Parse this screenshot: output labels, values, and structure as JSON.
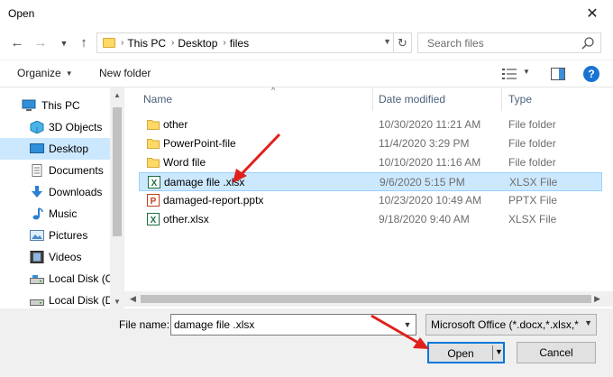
{
  "window": {
    "title": "Open"
  },
  "address": {
    "segments": [
      "This PC",
      "Desktop",
      "files"
    ]
  },
  "search": {
    "placeholder": "Search files"
  },
  "toolbar": {
    "organize": "Organize",
    "new_folder": "New folder"
  },
  "sidebar": {
    "items": [
      {
        "label": "This PC",
        "icon": "computer-icon"
      },
      {
        "label": "3D Objects",
        "icon": "cube-icon"
      },
      {
        "label": "Desktop",
        "icon": "desktop-icon",
        "selected": true
      },
      {
        "label": "Documents",
        "icon": "document-icon"
      },
      {
        "label": "Downloads",
        "icon": "download-icon"
      },
      {
        "label": "Music",
        "icon": "music-icon"
      },
      {
        "label": "Pictures",
        "icon": "pictures-icon"
      },
      {
        "label": "Videos",
        "icon": "video-icon"
      },
      {
        "label": "Local Disk (C",
        "icon": "disk-icon"
      },
      {
        "label": "Local Disk (D",
        "icon": "disk-icon"
      }
    ]
  },
  "columns": {
    "name": "Name",
    "date": "Date modified",
    "type": "Type"
  },
  "files": [
    {
      "name": "other",
      "date": "10/30/2020 11:21 AM",
      "type": "File folder",
      "icon": "folder-icon"
    },
    {
      "name": "PowerPoint-file",
      "date": "11/4/2020 3:29 PM",
      "type": "File folder",
      "icon": "folder-icon"
    },
    {
      "name": "Word file",
      "date": "10/10/2020 11:16 AM",
      "type": "File folder",
      "icon": "folder-icon"
    },
    {
      "name": "damage file .xlsx",
      "date": "9/6/2020 5:15 PM",
      "type": "XLSX File",
      "icon": "excel-icon",
      "selected": true
    },
    {
      "name": "damaged-report.pptx",
      "date": "10/23/2020 10:49 AM",
      "type": "PPTX File",
      "icon": "powerpoint-icon"
    },
    {
      "name": "other.xlsx",
      "date": "9/18/2020 9:40 AM",
      "type": "XLSX File",
      "icon": "excel-icon"
    }
  ],
  "footer": {
    "file_name_label": "File name:",
    "file_name_value": "damage file .xlsx",
    "filter_value": "Microsoft Office (*.docx,*.xlsx,*",
    "open_label": "Open",
    "cancel_label": "Cancel"
  },
  "colors": {
    "selection": "#cce8ff",
    "accent": "#0078d7",
    "annotation": "#e0201b"
  }
}
